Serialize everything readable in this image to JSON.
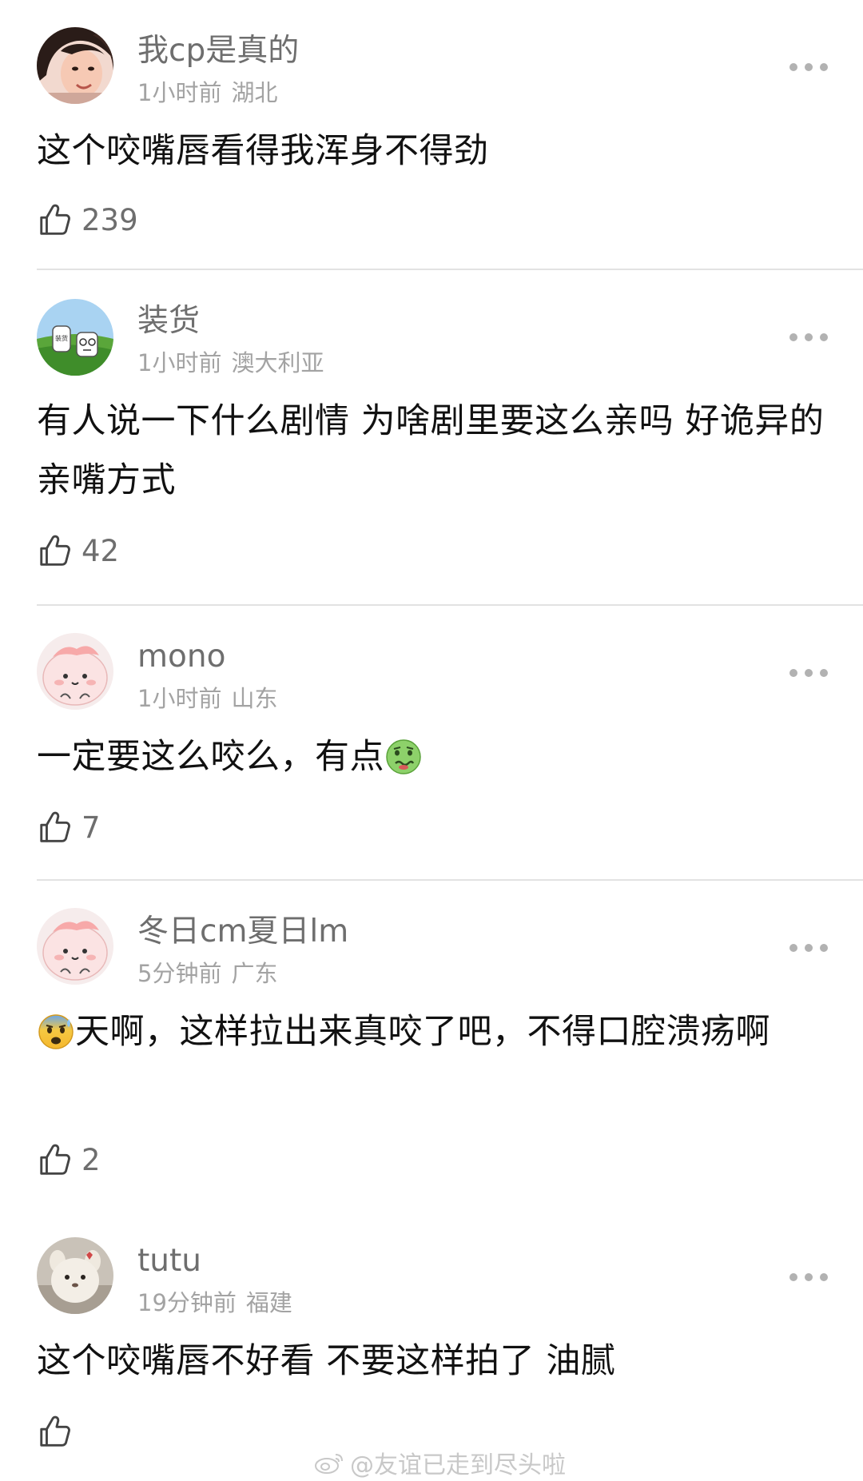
{
  "comments": [
    {
      "username": "我cp是真的",
      "time": "1小时前",
      "location": "湖北",
      "text": "这个咬嘴唇看得我浑身不得劲",
      "likes": "239",
      "avatar_icon": "woman-photo-avatar"
    },
    {
      "username": "装货",
      "time": "1小时前",
      "location": "澳大利亚",
      "text": "有人说一下什么剧情 为啥剧里要这么亲吗 好诡异的亲嘴方式",
      "likes": "42",
      "avatar_icon": "cartoon-landscape-avatar",
      "avatar_sign_text": "装货"
    },
    {
      "username": "mono",
      "time": "1小时前",
      "location": "山东",
      "text": "一定要这么咬么，有点",
      "text_emoji": "nauseated-face-icon",
      "likes": "7",
      "avatar_icon": "pink-blob-avatar"
    },
    {
      "username": "冬日cm夏日lm",
      "time": "5分钟前",
      "location": "广东",
      "text_emoji": "anxious-sweat-face-icon",
      "text": "天啊，这样拉出来真咬了吧，不得口腔溃疡啊",
      "likes": "2",
      "avatar_icon": "pink-blob-avatar"
    },
    {
      "username": "tutu",
      "time": "19分钟前",
      "location": "福建",
      "text": "这个咬嘴唇不好看 不要这样拍了 油腻",
      "likes": "",
      "avatar_icon": "plush-toy-avatar"
    }
  ],
  "watermark": "@友谊已走到尽头啦",
  "colors": {
    "username": "#6e6e6e",
    "meta": "#a3a3a3",
    "body": "#111111",
    "divider": "#e2e2e2"
  }
}
